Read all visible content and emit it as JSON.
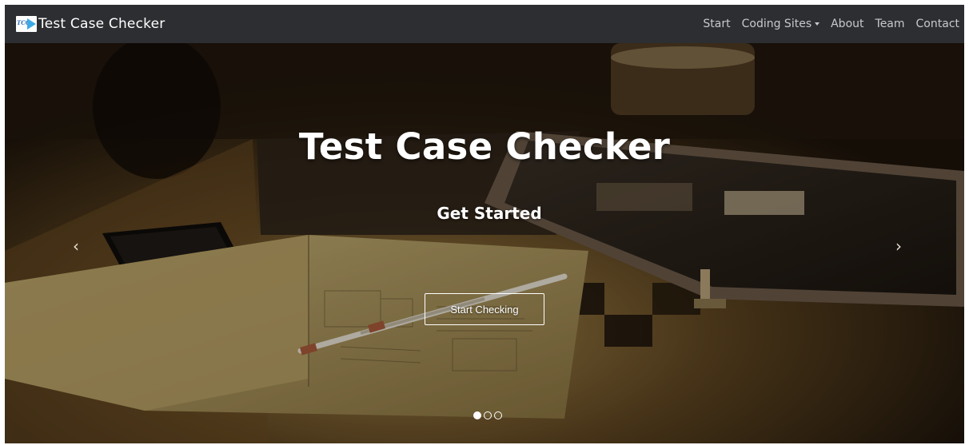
{
  "navbar": {
    "brand_logo_text": "TCC",
    "brand_title": "Test Case Checker",
    "links": [
      {
        "label": "Start"
      },
      {
        "label": "Coding Sites",
        "dropdown": true
      },
      {
        "label": "About"
      },
      {
        "label": "Team"
      },
      {
        "label": "Contact"
      }
    ]
  },
  "hero": {
    "title": "Test Case Checker",
    "subtitle": "Get Started",
    "button_label": "Start Checking",
    "prev_arrow": "‹",
    "next_arrow": "›",
    "slide_count": 3,
    "active_slide": 1
  },
  "icons": {
    "caret": "chevron-down-icon",
    "prev": "chevron-left-icon",
    "next": "chevron-right-icon"
  },
  "colors": {
    "navbar_bg": "#2c2e31",
    "nav_link": "#c7c9cc",
    "hero_text": "#ffffff"
  }
}
